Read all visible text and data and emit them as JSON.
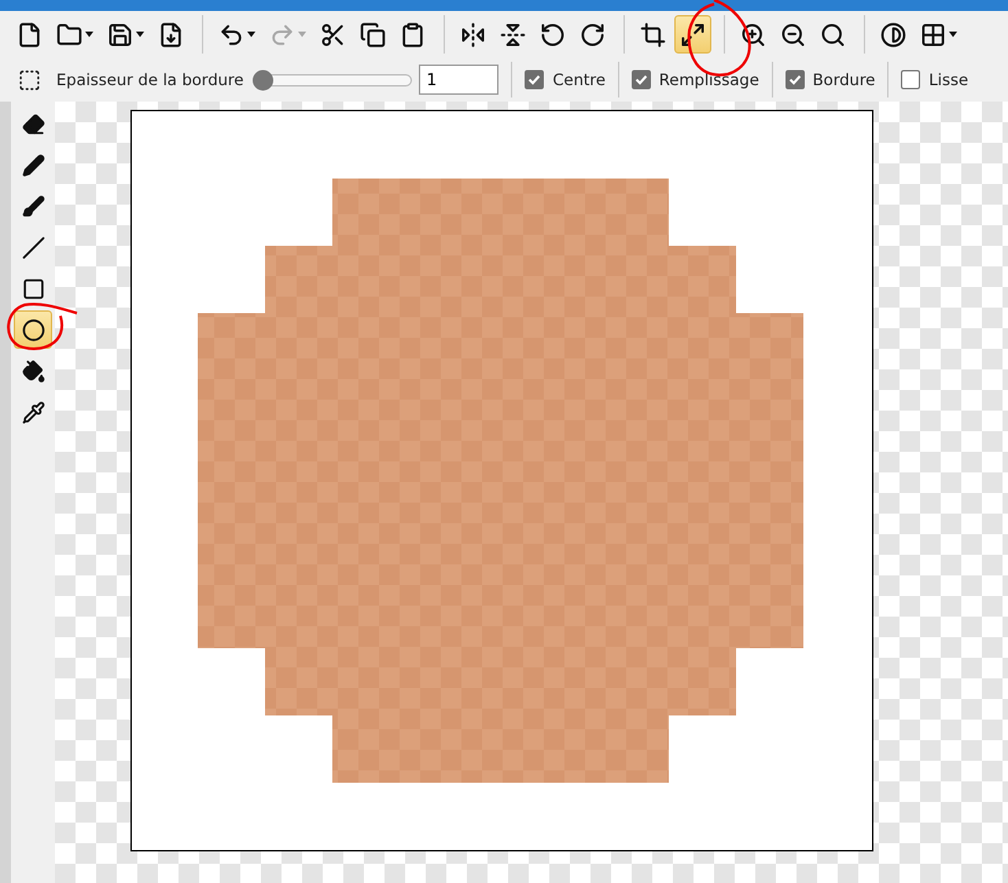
{
  "toolbar": [
    {
      "kind": "button",
      "dropdown": false,
      "disabled": false,
      "selected": false
    },
    {
      "kind": "button",
      "dropdown": true,
      "disabled": false,
      "selected": false
    },
    {
      "kind": "button",
      "dropdown": true,
      "disabled": false,
      "selected": false
    },
    {
      "kind": "button",
      "dropdown": false,
      "disabled": false,
      "selected": false
    },
    {
      "kind": "separator"
    },
    {
      "kind": "button",
      "dropdown": true,
      "disabled": false,
      "selected": false
    },
    {
      "kind": "button",
      "dropdown": true,
      "disabled": true,
      "selected": false
    },
    {
      "kind": "button",
      "dropdown": false,
      "disabled": false,
      "selected": false
    },
    {
      "kind": "button",
      "dropdown": false,
      "disabled": false,
      "selected": false
    },
    {
      "kind": "button",
      "dropdown": false,
      "disabled": false,
      "selected": false
    },
    {
      "kind": "separator"
    },
    {
      "kind": "button",
      "dropdown": false,
      "disabled": false,
      "selected": false
    },
    {
      "kind": "button",
      "dropdown": false,
      "disabled": false,
      "selected": false
    },
    {
      "kind": "button",
      "dropdown": false,
      "disabled": false,
      "selected": false
    },
    {
      "kind": "button",
      "dropdown": false,
      "disabled": false,
      "selected": false
    },
    {
      "kind": "separator"
    },
    {
      "kind": "button",
      "dropdown": false,
      "disabled": false,
      "selected": false
    },
    {
      "kind": "button",
      "dropdown": false,
      "disabled": false,
      "selected": true
    },
    {
      "kind": "separator"
    },
    {
      "kind": "button",
      "dropdown": false,
      "disabled": false,
      "selected": false
    },
    {
      "kind": "button",
      "dropdown": false,
      "disabled": false,
      "selected": false
    },
    {
      "kind": "button",
      "dropdown": false,
      "disabled": false,
      "selected": false
    },
    {
      "kind": "separator"
    },
    {
      "kind": "button",
      "dropdown": false,
      "disabled": false,
      "selected": false
    },
    {
      "kind": "button",
      "dropdown": true,
      "disabled": false,
      "selected": false
    }
  ],
  "options": {
    "border_width": {
      "label": "Epaisseur de la bordure",
      "level": 0,
      "value": "1"
    },
    "checkboxes": [
      {
        "label": "Centre",
        "checked": true
      },
      {
        "label": "Remplissage",
        "checked": true
      },
      {
        "label": "Bordure",
        "checked": true
      },
      {
        "label": "Lisse",
        "checked": false
      }
    ]
  },
  "tools": [
    {
      "selected": false
    },
    {
      "selected": false
    },
    {
      "selected": false
    },
    {
      "selected": false
    },
    {
      "selected": false
    },
    {
      "selected": true
    },
    {
      "selected": false
    },
    {
      "selected": false
    }
  ]
}
